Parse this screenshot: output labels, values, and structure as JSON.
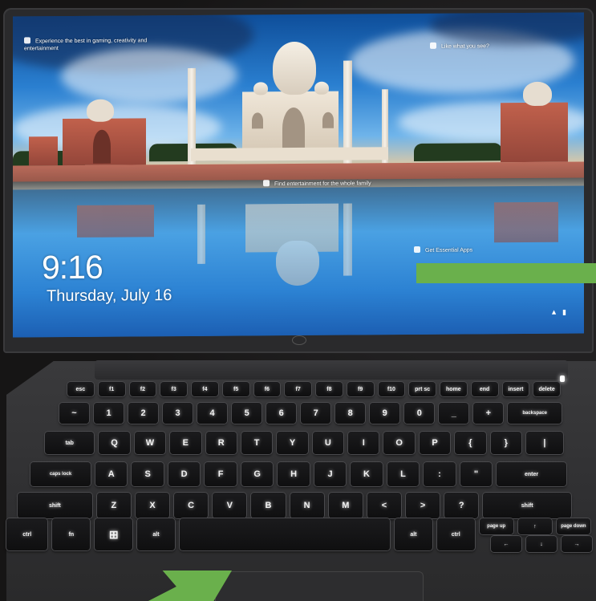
{
  "lockscreen": {
    "spotlight_top_left": "Experience the best in gaming, creativity and entertainment",
    "spotlight_top_right": "Like what you see?",
    "spotlight_middle": "Find entertainment for the whole family",
    "spotlight_lower_right": "Get Essential Apps",
    "time": "9:16",
    "date": "Thursday, July 16",
    "icons": {
      "spotlight": "camera-icon",
      "network": "network-icon",
      "battery": "battery-icon"
    }
  },
  "keyboard": {
    "row_fn": [
      "esc",
      "f1",
      "f2",
      "f3",
      "f4",
      "f5",
      "f6",
      "f7",
      "f8",
      "f9",
      "f10",
      "prt sc",
      "home",
      "end",
      "insert",
      "delete"
    ],
    "row_num": [
      "~",
      "1",
      "2",
      "3",
      "4",
      "5",
      "6",
      "7",
      "8",
      "9",
      "0",
      "_",
      "+",
      "backspace"
    ],
    "row_q": [
      "tab",
      "Q",
      "W",
      "E",
      "R",
      "T",
      "Y",
      "U",
      "I",
      "O",
      "P",
      "{",
      "}",
      "|"
    ],
    "row_a": [
      "caps lock",
      "A",
      "S",
      "D",
      "F",
      "G",
      "H",
      "J",
      "K",
      "L",
      ":",
      "\"",
      "enter"
    ],
    "row_z": [
      "shift",
      "Z",
      "X",
      "C",
      "V",
      "B",
      "N",
      "M",
      "<",
      ">",
      "?",
      "shift"
    ],
    "row_bottom": [
      "ctrl",
      "fn",
      "win",
      "alt",
      "",
      "alt",
      "ctrl",
      "page up",
      "↑",
      "page down"
    ],
    "row_arrows": [
      "←",
      "↓",
      "→"
    ]
  },
  "colors": {
    "marker": "#6ab04c"
  }
}
